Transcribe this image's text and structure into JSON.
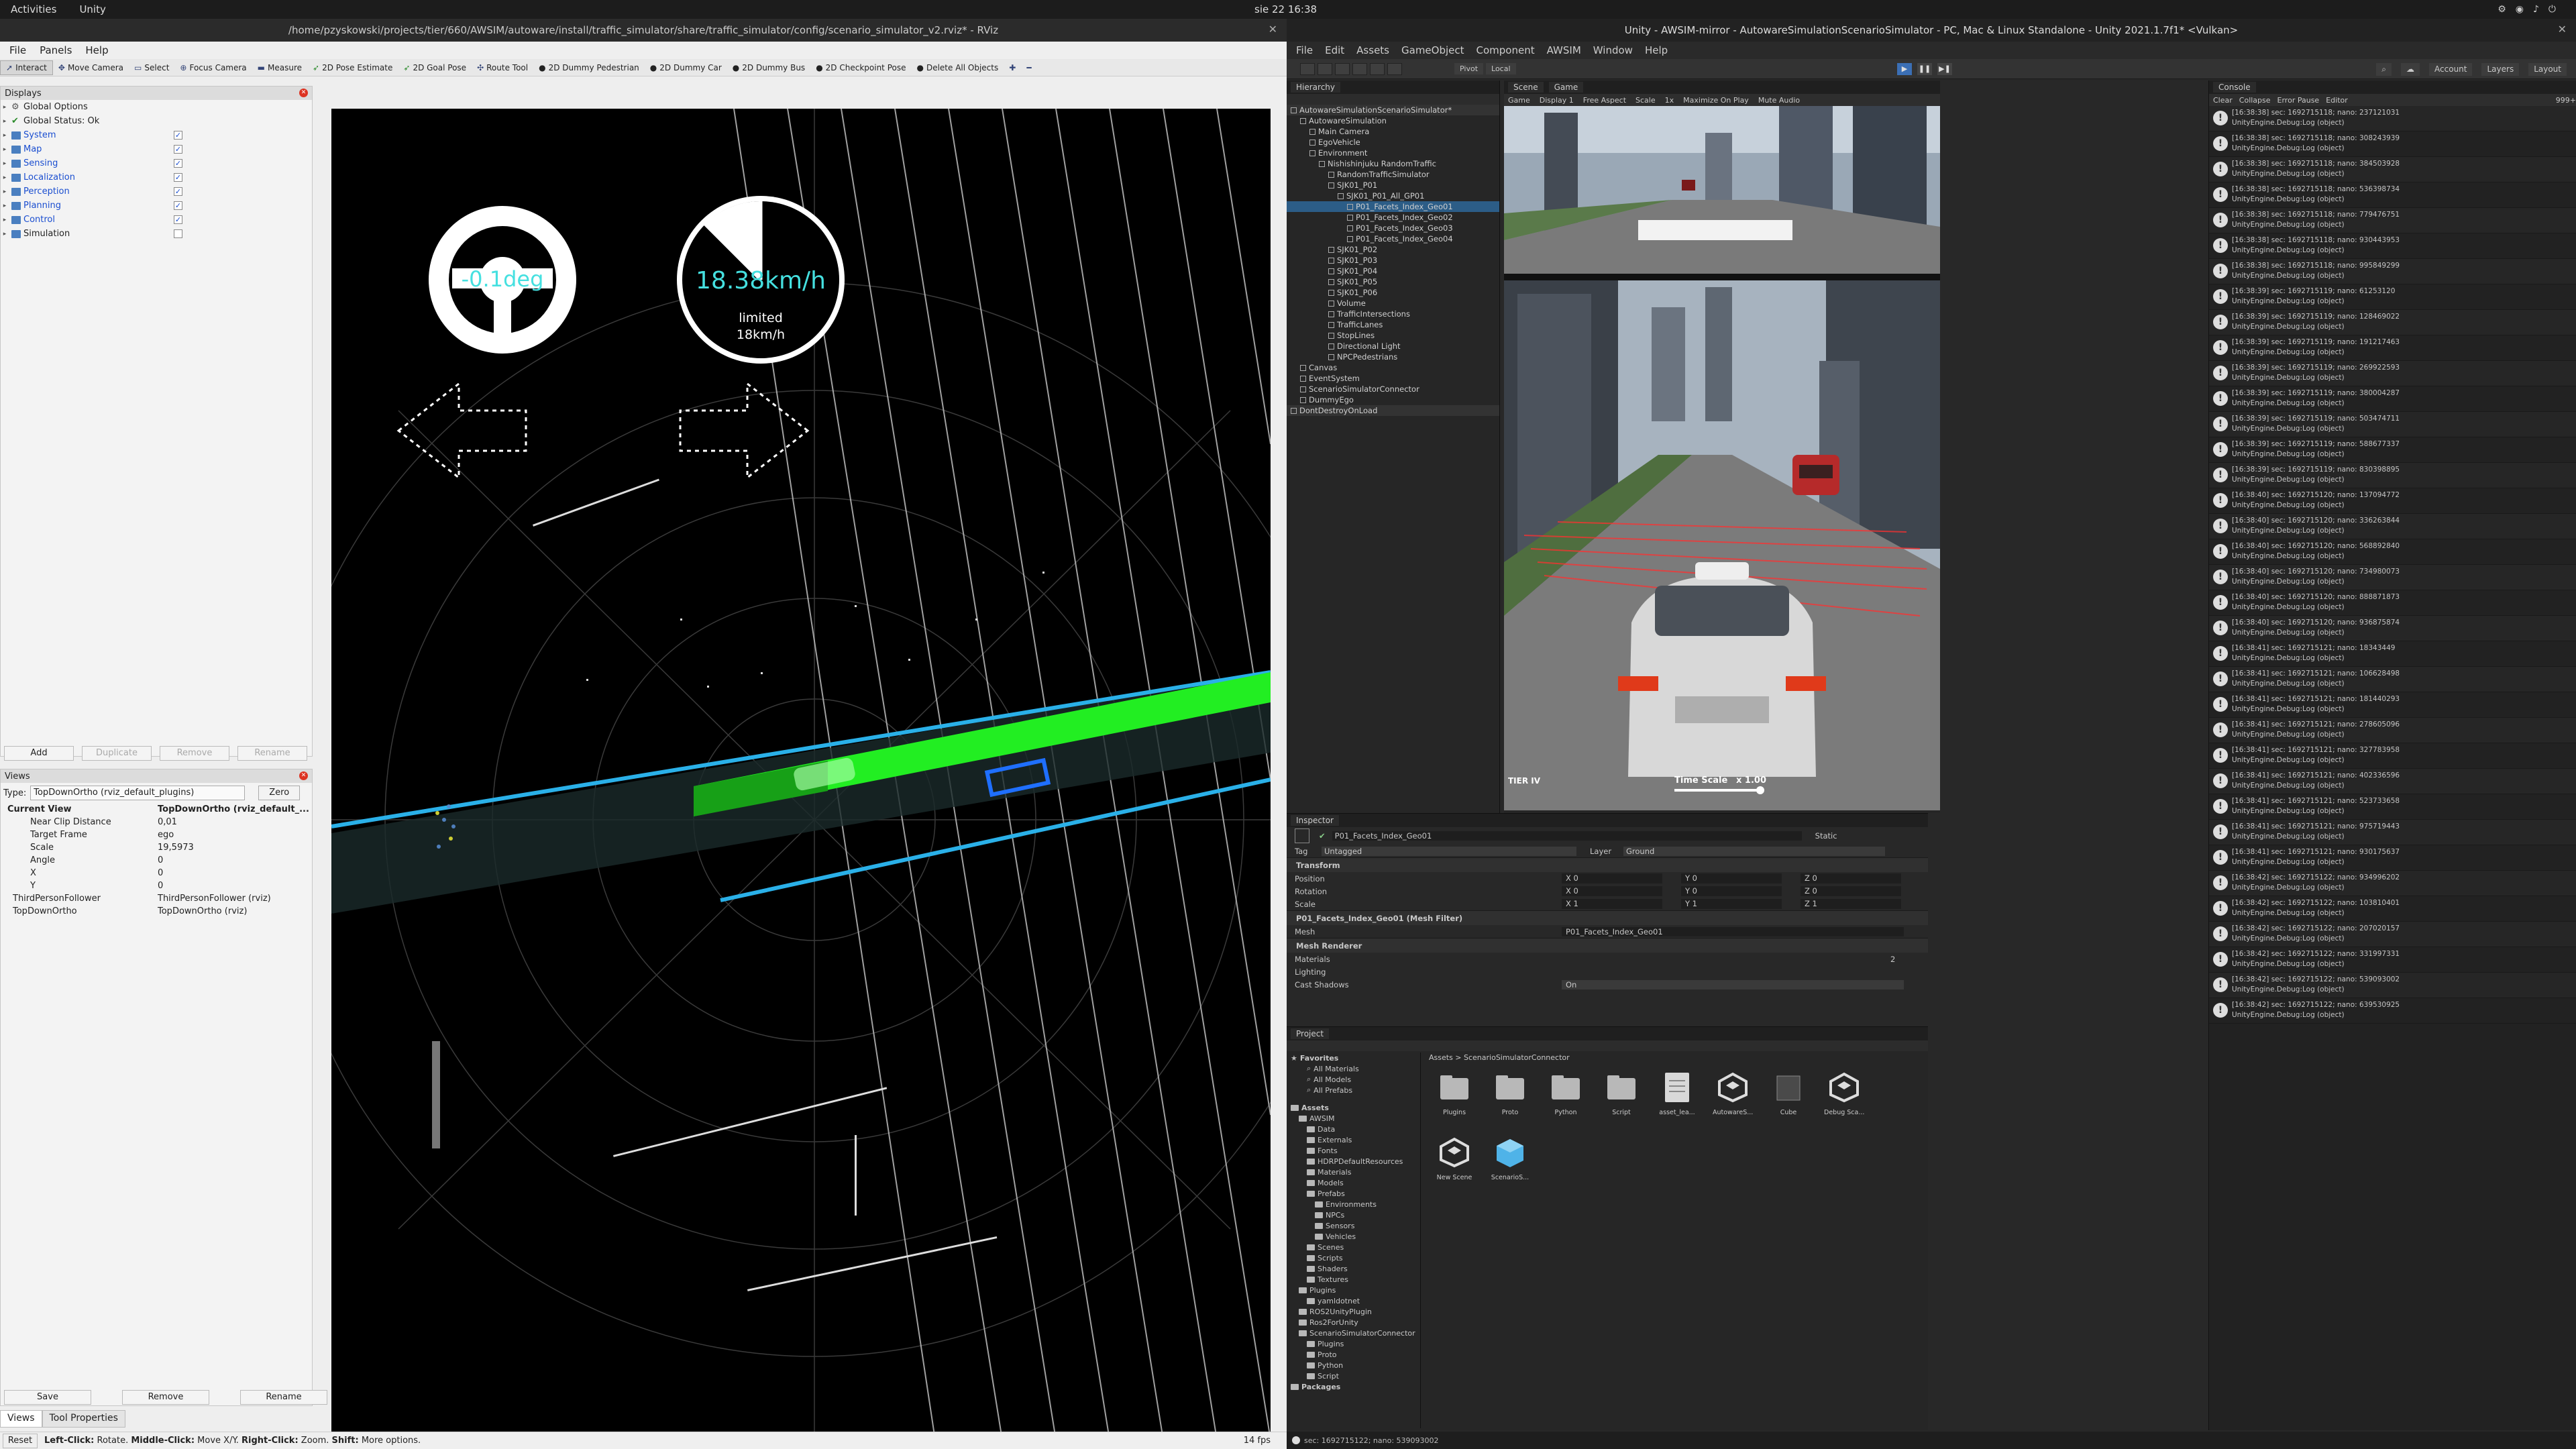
{
  "topbar": {
    "activities": "Activities",
    "app": "Unity",
    "clock": "sie 22  16:38"
  },
  "rviz": {
    "title": "/home/pzyskowski/projects/tier/660/AWSIM/autoware/install/traffic_simulator/share/traffic_simulator/config/scenario_simulator_v2.rviz* - RViz",
    "menu": [
      "File",
      "Panels",
      "Help"
    ],
    "tools": [
      "Interact",
      "Move Camera",
      "Select",
      "Focus Camera",
      "Measure",
      "2D Pose Estimate",
      "2D Goal Pose",
      "Route Tool",
      "2D Dummy Pedestrian",
      "2D Dummy Car",
      "2D Dummy Bus",
      "2D Checkpoint Pose",
      "Delete All Objects"
    ],
    "displays_title": "Displays",
    "displays": [
      {
        "label": "Global Options",
        "checked": null
      },
      {
        "label": "Global Status: Ok",
        "checked": null
      },
      {
        "label": "System",
        "checked": true
      },
      {
        "label": "Map",
        "checked": true
      },
      {
        "label": "Sensing",
        "checked": true
      },
      {
        "label": "Localization",
        "checked": true
      },
      {
        "label": "Perception",
        "checked": true
      },
      {
        "label": "Planning",
        "checked": true
      },
      {
        "label": "Control",
        "checked": true
      },
      {
        "label": "Simulation",
        "checked": false
      }
    ],
    "display_buttons": [
      "Add",
      "Duplicate",
      "Remove",
      "Rename"
    ],
    "views_title": "Views",
    "type_label": "Type:",
    "type_value": "TopDownOrtho (rviz_default_plugins)",
    "zero": "Zero",
    "views": [
      {
        "k": "Current View",
        "v": "TopDownOrtho (rviz_default_..."
      },
      {
        "k": "Near Clip Distance",
        "v": "0,01"
      },
      {
        "k": "Target Frame",
        "v": "ego"
      },
      {
        "k": "Scale",
        "v": "19,5973"
      },
      {
        "k": "Angle",
        "v": "0"
      },
      {
        "k": "X",
        "v": "0"
      },
      {
        "k": "Y",
        "v": "0"
      },
      {
        "k": "ThirdPersonFollower",
        "v": "ThirdPersonFollower (rviz)"
      },
      {
        "k": "TopDownOrtho",
        "v": "TopDownOrtho (rviz)"
      }
    ],
    "view_buttons": [
      "Save",
      "Remove",
      "Rename"
    ],
    "bottom_tabs": [
      "Views",
      "Tool Properties"
    ],
    "steer": "-0.1deg",
    "speed": "18.38km/h",
    "limited": "limited",
    "limit_val": "18km/h",
    "reset": "Reset",
    "status_hint_bold1": "Left-Click:",
    "status_hint1": " Rotate. ",
    "status_hint_bold2": "Middle-Click:",
    "status_hint2": " Move X/Y. ",
    "status_hint_bold3": "Right-Click:",
    "status_hint3": " Zoom. ",
    "status_hint_bold4": "Shift:",
    "status_hint4": " More options.",
    "fps": "14 fps"
  },
  "unity": {
    "title": "Unity - AWSIM-mirror - AutowareSimulationScenarioSimulator - PC, Mac & Linux Standalone - Unity 2021.1.7f1* <Vulkan>",
    "menu": [
      "File",
      "Edit",
      "Assets",
      "GameObject",
      "Component",
      "AWSIM",
      "Window",
      "Help"
    ],
    "pivot": "Pivot",
    "local": "Local",
    "right_tools": [
      "Account",
      "Layers",
      "Layout"
    ],
    "hierarchy_tab": "Hierarchy",
    "hierarchy": [
      {
        "t": "AutowareSimulationScenarioSimulator*",
        "d": 0,
        "cls": "scene"
      },
      {
        "t": "AutowareSimulation",
        "d": 1
      },
      {
        "t": "Main Camera",
        "d": 2
      },
      {
        "t": "EgoVehicle",
        "d": 2
      },
      {
        "t": "Environment",
        "d": 2
      },
      {
        "t": "Nishishinjuku RandomTraffic",
        "d": 3
      },
      {
        "t": "RandomTrafficSimulator",
        "d": 4
      },
      {
        "t": "SJK01_P01",
        "d": 4
      },
      {
        "t": "SJK01_P01_All_GP01",
        "d": 5
      },
      {
        "t": "P01_Facets_Index_Geo01",
        "d": 6,
        "cls": "sel"
      },
      {
        "t": "P01_Facets_Index_Geo02",
        "d": 6
      },
      {
        "t": "P01_Facets_Index_Geo03",
        "d": 6
      },
      {
        "t": "P01_Facets_Index_Geo04",
        "d": 6
      },
      {
        "t": "SJK01_P02",
        "d": 4
      },
      {
        "t": "SJK01_P03",
        "d": 4
      },
      {
        "t": "SJK01_P04",
        "d": 4
      },
      {
        "t": "SJK01_P05",
        "d": 4
      },
      {
        "t": "SJK01_P06",
        "d": 4
      },
      {
        "t": "Volume",
        "d": 4
      },
      {
        "t": "TrafficIntersections",
        "d": 4
      },
      {
        "t": "TrafficLanes",
        "d": 4
      },
      {
        "t": "StopLines",
        "d": 4
      },
      {
        "t": "Directional Light",
        "d": 4
      },
      {
        "t": "NPCPedestrians",
        "d": 4
      },
      {
        "t": "Canvas",
        "d": 1
      },
      {
        "t": "EventSystem",
        "d": 1
      },
      {
        "t": "ScenarioSimulatorConnector",
        "d": 1
      },
      {
        "t": "DummyEgo",
        "d": 1
      },
      {
        "t": "DontDestroyOnLoad",
        "d": 0,
        "cls": "scene"
      }
    ],
    "scene_tab": "Scene",
    "game_tab": "Game",
    "game_toolbar": [
      "Game",
      "Display 1",
      "Free Aspect",
      "Scale",
      "1x",
      "Maximize On Play",
      "Mute Audio"
    ],
    "timescale": "Time Scale",
    "timescale_val": "x 1.00",
    "brand": "TIER IV",
    "console_tab": "Console",
    "console_toolbar": [
      "Clear",
      "Collapse",
      "Error Pause",
      "Editor"
    ],
    "console_count": "999+",
    "logs": [
      "[16:38:38] sec: 1692715118; nano: 237121031",
      "[16:38:38] sec: 1692715118; nano: 308243939",
      "[16:38:38] sec: 1692715118; nano: 384503928",
      "[16:38:38] sec: 1692715118; nano: 536398734",
      "[16:38:38] sec: 1692715118; nano: 779476751",
      "[16:38:38] sec: 1692715118; nano: 930443953",
      "[16:38:38] sec: 1692715118; nano: 995849299",
      "[16:38:39] sec: 1692715119; nano: 61253120",
      "[16:38:39] sec: 1692715119; nano: 128469022",
      "[16:38:39] sec: 1692715119; nano: 191217463",
      "[16:38:39] sec: 1692715119; nano: 269922593",
      "[16:38:39] sec: 1692715119; nano: 380004287",
      "[16:38:39] sec: 1692715119; nano: 503474711",
      "[16:38:39] sec: 1692715119; nano: 588677337",
      "[16:38:39] sec: 1692715119; nano: 830398895",
      "[16:38:40] sec: 1692715120; nano: 137094772",
      "[16:38:40] sec: 1692715120; nano: 336263844",
      "[16:38:40] sec: 1692715120; nano: 568892840",
      "[16:38:40] sec: 1692715120; nano: 734980073",
      "[16:38:40] sec: 1692715120; nano: 888871873",
      "[16:38:40] sec: 1692715120; nano: 936875874",
      "[16:38:41] sec: 1692715121; nano: 18343449",
      "[16:38:41] sec: 1692715121; nano: 106628498",
      "[16:38:41] sec: 1692715121; nano: 181440293",
      "[16:38:41] sec: 1692715121; nano: 278605096",
      "[16:38:41] sec: 1692715121; nano: 327783958",
      "[16:38:41] sec: 1692715121; nano: 402336596",
      "[16:38:41] sec: 1692715121; nano: 523733658",
      "[16:38:41] sec: 1692715121; nano: 975719443",
      "[16:38:41] sec: 1692715121; nano: 930175637",
      "[16:38:42] sec: 1692715122; nano: 934996202",
      "[16:38:42] sec: 1692715122; nano: 103810401",
      "[16:38:42] sec: 1692715122; nano: 207020157",
      "[16:38:42] sec: 1692715122; nano: 331997331",
      "[16:38:42] sec: 1692715122; nano: 539093002",
      "[16:38:42] sec: 1692715122; nano: 639530925"
    ],
    "log_sub": "UnityEngine.Debug:Log (object)",
    "inspector_tab": "Inspector",
    "obj_name": "P01_Facets_Index_Geo01",
    "static": "Static",
    "tag_label": "Tag",
    "tag_val": "Untagged",
    "layer_label": "Layer",
    "layer_val": "Ground",
    "transform": "Transform",
    "pos_label": "Position",
    "rot_label": "Rotation",
    "scale_label": "Scale",
    "pos": [
      "X 0",
      "Y 0",
      "Z 0"
    ],
    "rot": [
      "X 0",
      "Y 0",
      "Z 0"
    ],
    "scl": [
      "X 1",
      "Y 1",
      "Z 1"
    ],
    "mesh_filter": "P01_Facets_Index_Geo01 (Mesh Filter)",
    "mesh_label": "Mesh",
    "mesh_val": "P01_Facets_Index_Geo01",
    "mesh_renderer": "Mesh Renderer",
    "materials": "Materials",
    "materials_n": "2",
    "lighting": "Lighting",
    "cast_shadows": "Cast Shadows",
    "cast_val": "On",
    "project_tab": "Project",
    "favorites": [
      "Favorites",
      "All Materials",
      "All Models",
      "All Prefabs"
    ],
    "ptree": [
      {
        "t": "Assets",
        "d": 0
      },
      {
        "t": "AWSIM",
        "d": 1
      },
      {
        "t": "Data",
        "d": 2
      },
      {
        "t": "Externals",
        "d": 2
      },
      {
        "t": "Fonts",
        "d": 2
      },
      {
        "t": "HDRPDefaultResources",
        "d": 2
      },
      {
        "t": "Materials",
        "d": 2
      },
      {
        "t": "Models",
        "d": 2
      },
      {
        "t": "Prefabs",
        "d": 2
      },
      {
        "t": "Environments",
        "d": 3
      },
      {
        "t": "NPCs",
        "d": 3
      },
      {
        "t": "Sensors",
        "d": 3
      },
      {
        "t": "Vehicles",
        "d": 3
      },
      {
        "t": "Scenes",
        "d": 2
      },
      {
        "t": "Scripts",
        "d": 2
      },
      {
        "t": "Shaders",
        "d": 2
      },
      {
        "t": "Textures",
        "d": 2
      },
      {
        "t": "Plugins",
        "d": 1
      },
      {
        "t": "yamldotnet",
        "d": 2
      },
      {
        "t": "ROS2UnityPlugin",
        "d": 1
      },
      {
        "t": "Ros2ForUnity",
        "d": 1
      },
      {
        "t": "ScenarioSimulatorConnector",
        "d": 1
      },
      {
        "t": "Plugins",
        "d": 2
      },
      {
        "t": "Proto",
        "d": 2
      },
      {
        "t": "Python",
        "d": 2
      },
      {
        "t": "Script",
        "d": 2
      },
      {
        "t": "Packages",
        "d": 0
      }
    ],
    "crumb": "Assets > ScenarioSimulatorConnector",
    "assets": [
      {
        "t": "Plugins",
        "k": "folder"
      },
      {
        "t": "Proto",
        "k": "folder"
      },
      {
        "t": "Python",
        "k": "folder"
      },
      {
        "t": "Script",
        "k": "folder"
      },
      {
        "t": "asset_lea...",
        "k": "doc"
      },
      {
        "t": "AutowareS...",
        "k": "unity"
      },
      {
        "t": "Cube",
        "k": "cube"
      },
      {
        "t": "Debug Sca...",
        "k": "unity"
      },
      {
        "t": "New Scene",
        "k": "unity"
      },
      {
        "t": "ScenarioS...",
        "k": "cubeblue"
      }
    ],
    "status": "sec: 1692715122; nano: 539093002"
  }
}
